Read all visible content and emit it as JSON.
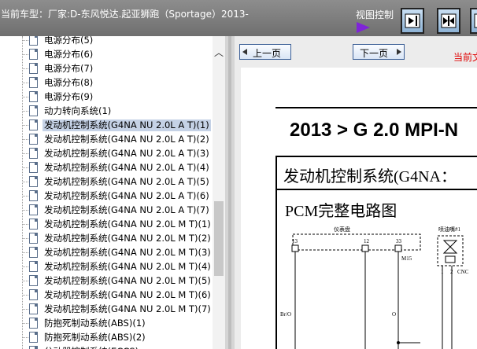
{
  "header": {
    "vehicle_label": "当前车型：厂家:D-东风悦达.起亚狮跑（Sportage）2013-",
    "view_control_label": "视图控制",
    "view_buttons": [
      "panel-right-icon",
      "split-view-icon",
      "panel-left-icon"
    ]
  },
  "tree": {
    "items": [
      {
        "label": "电源分布(5)"
      },
      {
        "label": "电源分布(6)"
      },
      {
        "label": "电源分布(7)"
      },
      {
        "label": "电源分布(8)"
      },
      {
        "label": "电源分布(9)"
      },
      {
        "label": "动力转向系统(1)"
      },
      {
        "label": "发动机控制系统(G4NA NU 2.0L A T)(1)"
      },
      {
        "label": "发动机控制系统(G4NA NU 2.0L A T)(2)"
      },
      {
        "label": "发动机控制系统(G4NA NU 2.0L A T)(3)"
      },
      {
        "label": "发动机控制系统(G4NA NU 2.0L A T)(4)"
      },
      {
        "label": "发动机控制系统(G4NA NU 2.0L A T)(5)"
      },
      {
        "label": "发动机控制系统(G4NA NU 2.0L A T)(6)"
      },
      {
        "label": "发动机控制系统(G4NA NU 2.0L A T)(7)"
      },
      {
        "label": "发动机控制系统(G4NA NU 2.0L M T)(1)"
      },
      {
        "label": "发动机控制系统(G4NA NU 2.0L M T)(2)"
      },
      {
        "label": "发动机控制系统(G4NA NU 2.0L M T)(3)"
      },
      {
        "label": "发动机控制系统(G4NA NU 2.0L M T)(4)"
      },
      {
        "label": "发动机控制系统(G4NA NU 2.0L M T)(5)"
      },
      {
        "label": "发动机控制系统(G4NA NU 2.0L M T)(6)"
      },
      {
        "label": "发动机控制系统(G4NA NU 2.0L M T)(7)"
      },
      {
        "label": "防抱死制动系统(ABS)(1)"
      },
      {
        "label": "防抱死制动系统(ABS)(2)"
      },
      {
        "label": "分动器控制系统(ECCS)"
      }
    ],
    "selected_label": "发动机控制系统(G4NA NU 2.0L A T)(1)"
  },
  "viewer": {
    "prev_page": "上一页",
    "next_page": "下一页",
    "current_label": "当前文",
    "doc_title": "2013 > G 2.0 MPI-N",
    "section_title": "发动机控制系统(G4NA：",
    "subtitle": "PCM完整电路图",
    "diagram": {
      "cluster_label": "仪表盘",
      "injector_label": "喷油嘴#1",
      "pin_13": "13",
      "pin_12": "12",
      "pin_33": "33",
      "conn_m15": "M15",
      "wire_bro": "Br/O",
      "wire_o": "O",
      "pin_1": "1",
      "pin_2": "2",
      "conn_cn": "CNC"
    }
  },
  "colors": {
    "topbar": "#7e7e7e",
    "selection": "#c5d2e6",
    "accent_purple": "#7f24d8",
    "current_red": "#e00000"
  }
}
